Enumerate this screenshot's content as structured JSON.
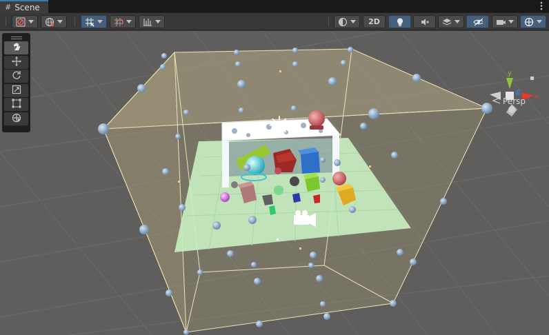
{
  "window": {
    "tab_title": "Scene",
    "tab_icon": "grid-hash-icon",
    "menu_icon": "kebab-menu-icon"
  },
  "toolbar": {
    "left": [
      {
        "name": "draw-mode-button",
        "icon": "shading-circle-icon",
        "dropdown": true
      },
      {
        "name": "global-local-button",
        "icon": "globe-icon",
        "dropdown": true
      },
      {
        "name": "grid-snapping-button",
        "icon": "grid-snap-icon",
        "dropdown": true,
        "active": true
      },
      {
        "name": "incremental-snap-button",
        "icon": "increment-snap-icon",
        "dropdown": true
      },
      {
        "name": "ruler-button",
        "icon": "ruler-icon",
        "dropdown": true
      }
    ],
    "right": {
      "render_mode_icon": "render-mode-circle-icon",
      "two_d_label": "2D",
      "lighting_icon": "lightbulb-icon",
      "audio_icon": "audio-mute-icon",
      "effects_icon": "effects-layers-icon",
      "hidden_icon": "visibility-eye-slash-icon",
      "camera_icon": "camera-icon",
      "gizmos_icon": "gizmos-sphere-icon"
    }
  },
  "tools": [
    {
      "name": "hand-tool",
      "icon": "hand-icon",
      "active": true
    },
    {
      "name": "move-tool",
      "icon": "move-arrows-icon"
    },
    {
      "name": "rotate-tool",
      "icon": "rotate-icon"
    },
    {
      "name": "scale-tool",
      "icon": "scale-icon"
    },
    {
      "name": "rect-tool",
      "icon": "rect-transform-icon"
    },
    {
      "name": "transform-tool",
      "icon": "transform-all-icon"
    }
  ],
  "gizmo": {
    "y_label": "y",
    "x_label": "x",
    "y_color": "#8cc43c",
    "x_color": "#e33b2e",
    "z_color": "#3a7fd8"
  },
  "view": {
    "projection_label": "Persp",
    "projection_icon": "persp-lines-icon"
  },
  "colors": {
    "accent": "#3a79bb",
    "active_button": "#46607c",
    "light_probe": "#a7c3e0",
    "probe_volume": "#d8c99a",
    "plane": "#c8f0c2"
  }
}
